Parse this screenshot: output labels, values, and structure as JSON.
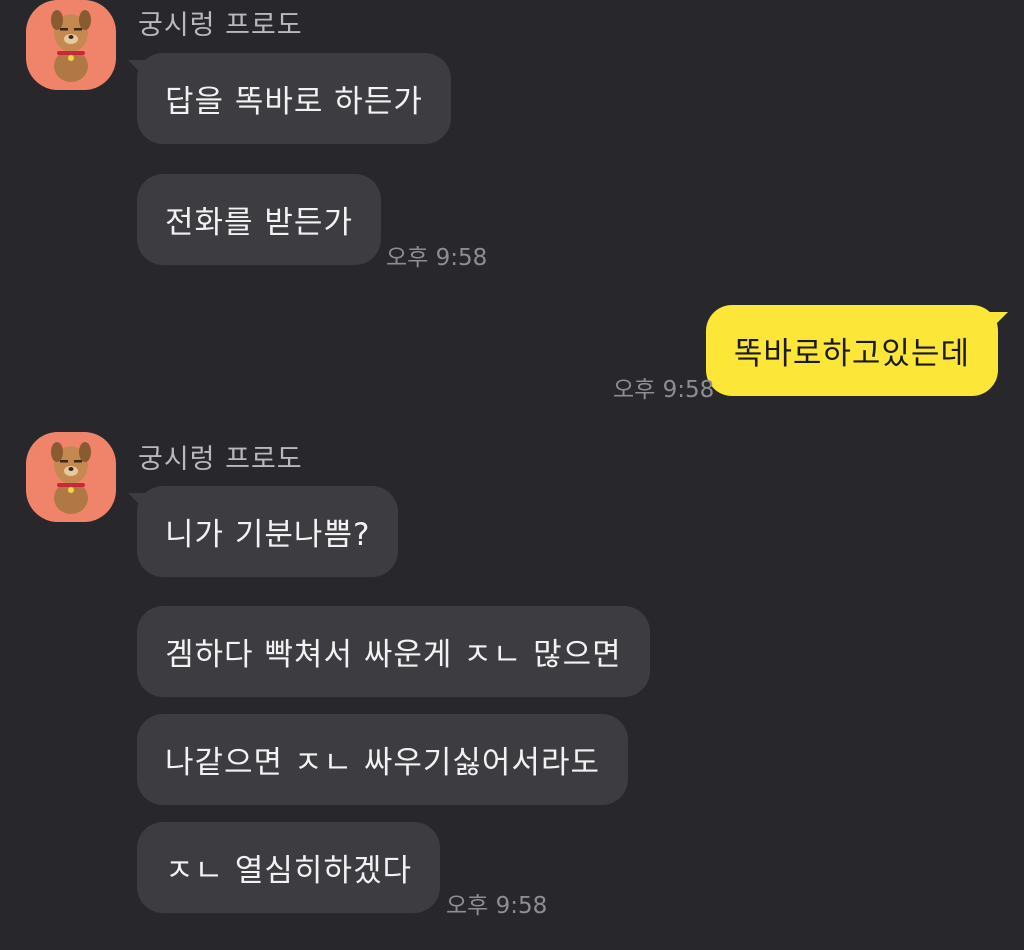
{
  "chat": {
    "group1": {
      "sender": "궁시렁 프로도",
      "avatar_icon": "frodo-dog-avatar-icon",
      "messages": [
        "답을 똑바로 하든가",
        "전화를 받든가"
      ],
      "time": "오후 9:58"
    },
    "mine": {
      "messages": [
        "똑바로하고있는데"
      ],
      "time": "오후 9:58"
    },
    "group2": {
      "sender": "궁시렁 프로도",
      "avatar_icon": "frodo-dog-avatar-icon",
      "messages": [
        "니가 기분나쁨?",
        "겜하다 빡쳐서 싸운게 ㅈㄴ 많으면",
        "나같으면 ㅈㄴ 싸우기싫어서라도",
        "ㅈㄴ 열심히하겠다"
      ],
      "time": "오후 9:58"
    }
  },
  "colors": {
    "background": "#28282c",
    "incoming_bubble": "#3c3c41",
    "outgoing_bubble": "#fce638",
    "avatar_bg": "#f0846a"
  }
}
